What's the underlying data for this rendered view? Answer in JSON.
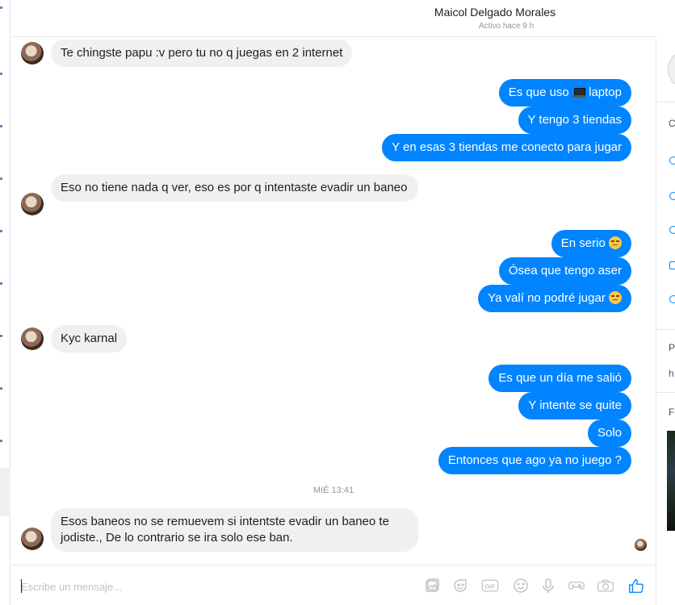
{
  "header": {
    "name": "Maicol Delgado Morales",
    "status": "Activo hace 9 h"
  },
  "messages": [
    {
      "text": "Te chingste papu :v pero tu no q juegas en 2 internet"
    },
    {
      "text_before": "Es que uso",
      "emoji": "laptop",
      "text_after": " laptop"
    },
    {
      "text": "Y tengo 3 tiendas"
    },
    {
      "text": "Y en esas 3 tiendas me conecto para jugar"
    },
    {
      "text": "Eso no tiene nada q ver, eso es por q intentaste evadir un baneo"
    },
    {
      "text": "En serio",
      "emoji": "disappointed-face"
    },
    {
      "text": "Ósea que tengo aser"
    },
    {
      "text": "Ya valí no podré jugar",
      "emoji": "disappointed-face"
    },
    {
      "text": "Kyc karnal"
    },
    {
      "text": "Es que un día me salió"
    },
    {
      "text": "Y intente se quite"
    },
    {
      "text": "Solo"
    },
    {
      "text": "Entonces que ago ya no juego ?"
    },
    {
      "text": "Esos baneos no se remuevem si intentste evadir un baneo te jodiste., De lo contrario se ira solo ese ban."
    }
  ],
  "timestamp": "MIÉ 13:41",
  "composer": {
    "placeholder": "Escribe un mensaje...",
    "tools": [
      "photo-icon",
      "sticker-icon",
      "gif-icon",
      "emoji-icon",
      "microphone-icon",
      "game-controller-icon",
      "camera-icon",
      "like-icon"
    ],
    "gif_label": "GIF"
  },
  "right_pane": {
    "letters": [
      "C",
      "P",
      "h",
      "F"
    ]
  },
  "colors": {
    "outgoing": "#0084ff",
    "incoming": "#f1f0f0",
    "icon": "#bec3c9"
  }
}
